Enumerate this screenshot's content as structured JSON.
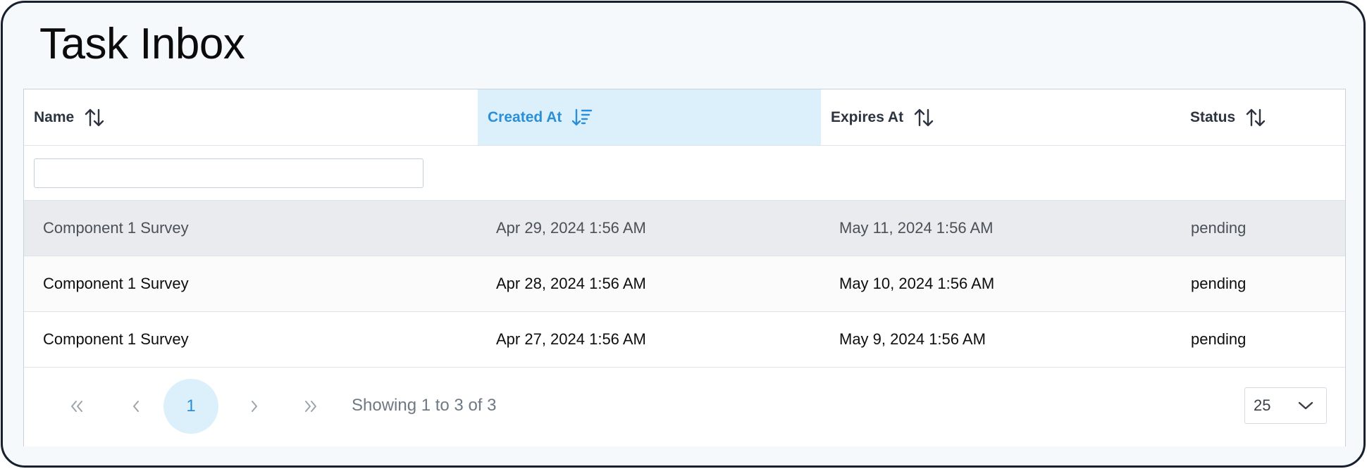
{
  "page": {
    "title": "Task Inbox"
  },
  "table": {
    "columns": [
      {
        "label": "Name",
        "sort": "none"
      },
      {
        "label": "Created At",
        "sort": "descending"
      },
      {
        "label": "Expires At",
        "sort": "none"
      },
      {
        "label": "Status",
        "sort": "none"
      }
    ],
    "filter": {
      "value": "",
      "placeholder": ""
    },
    "rows": [
      {
        "name": "Component 1 Survey",
        "created_at": "Apr 29, 2024 1:56 AM",
        "expires_at": "May 11, 2024 1:56 AM",
        "status": "pending"
      },
      {
        "name": "Component 1 Survey",
        "created_at": "Apr 28, 2024 1:56 AM",
        "expires_at": "May 10, 2024 1:56 AM",
        "status": "pending"
      },
      {
        "name": "Component 1 Survey",
        "created_at": "Apr 27, 2024 1:56 AM",
        "expires_at": "May 9, 2024 1:56 AM",
        "status": "pending"
      }
    ]
  },
  "pagination": {
    "current_page": "1",
    "summary": "Showing 1 to 3 of 3",
    "page_size": "25",
    "icons": {
      "first": "chevrons-left-icon",
      "prev": "chevron-left-icon",
      "next": "chevron-right-icon",
      "last": "chevrons-right-icon",
      "page_size_toggle": "chevron-down-icon"
    }
  },
  "colors": {
    "accent": "#2b8fd8",
    "accent_bg": "#dcf0fc",
    "frame_border": "#17202e",
    "highlight_row": "#e9ebee"
  }
}
